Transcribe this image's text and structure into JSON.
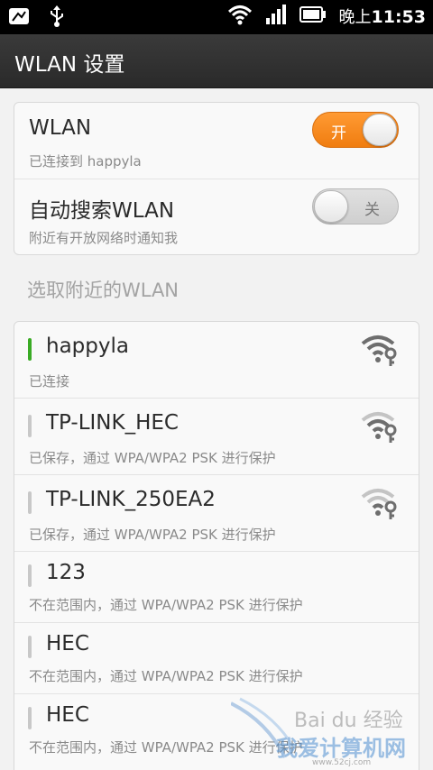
{
  "status_bar": {
    "time_prefix": "晚上",
    "time": "11:53",
    "icons": [
      "usb-debug-icon",
      "usb-icon",
      "wifi-signal-icon",
      "cell-signal-icon",
      "battery-icon"
    ]
  },
  "title_bar": {
    "title": "WLAN 设置"
  },
  "toggles": {
    "wlan": {
      "label": "WLAN",
      "sub": "已连接到 happyla",
      "state_label": "开",
      "on": true
    },
    "auto_search": {
      "label": "自动搜索WLAN",
      "sub": "附近有开放网络时通知我",
      "state_label": "关",
      "on": false
    }
  },
  "section": {
    "header": "选取附近的WLAN"
  },
  "networks": [
    {
      "name": "happyla",
      "status": "已连接",
      "connected": true,
      "icon": "wifi-secured-icon"
    },
    {
      "name": "TP-LINK_HEC",
      "status": "已保存，通过 WPA/WPA2 PSK 进行保护",
      "connected": false,
      "icon": "wifi-secured-icon"
    },
    {
      "name": "TP-LINK_250EA2",
      "status": "已保存，通过 WPA/WPA2 PSK 进行保护",
      "connected": false,
      "icon": "wifi-secured-icon"
    },
    {
      "name": "123",
      "status": "不在范围内，通过 WPA/WPA2 PSK 进行保护",
      "connected": false
    },
    {
      "name": "HEC",
      "status": "不在范围内，通过 WPA/WPA2 PSK 进行保护",
      "connected": false
    },
    {
      "name": "HEC",
      "status": "不在范围内，通过 WPA/WPA2 PSK 进行保护",
      "connected": false
    }
  ],
  "watermark": {
    "text": "我爱计算机网",
    "url": "www.52cj.com"
  },
  "colors": {
    "accent": "#f07d10",
    "connected": "#3aab25",
    "text": "#2b2b2b",
    "subtext": "#8a8a8a"
  }
}
